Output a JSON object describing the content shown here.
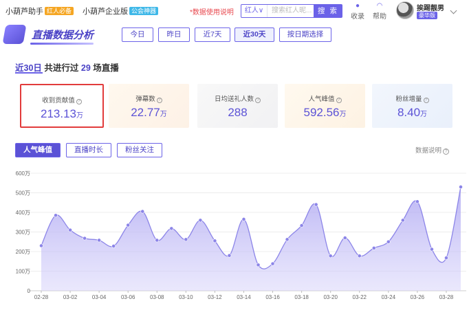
{
  "topbar": {
    "brand1": {
      "name": "小葫芦助手",
      "tag": "红人必备",
      "tag_color": "#f5a623"
    },
    "brand2": {
      "name": "小葫芦企业版",
      "tag": "公会神器",
      "tag_color": "#3fb8e8"
    },
    "warning": "*数据使用说明",
    "search": {
      "category": "红人∨",
      "placeholder": "搜索红人昵...",
      "button": "搜 索"
    },
    "tools": [
      {
        "label": "收录",
        "icon": "bag-icon"
      },
      {
        "label": "帮助",
        "icon": "headset-icon"
      }
    ],
    "user": {
      "name": "挨踢靓男",
      "badge": "豪华版"
    }
  },
  "section": {
    "title": "直播数据分析",
    "ranges": [
      "今日",
      "昨日",
      "近7天",
      "近30天",
      "按日期选择"
    ],
    "active_range": "近30天"
  },
  "summary": {
    "period": "近30日",
    "pre": "共进行过",
    "count": "29",
    "post": "场直播"
  },
  "stats": [
    {
      "label": "收到贡献值",
      "value": "213.13",
      "unit": "万"
    },
    {
      "label": "弹幕数",
      "value": "22.77",
      "unit": "万"
    },
    {
      "label": "日均送礼人数",
      "value": "288",
      "unit": ""
    },
    {
      "label": "人气峰值",
      "value": "592.56",
      "unit": "万"
    },
    {
      "label": "粉丝增量",
      "value": "8.40",
      "unit": "万"
    }
  ],
  "metric_tabs": [
    "人气峰值",
    "直播时长",
    "粉丝关注"
  ],
  "active_metric": "人气峰值",
  "data_note": "数据说明",
  "colors": {
    "accent": "#5b52d6",
    "line": "#8c85e8",
    "highlight": "#e23b3b"
  },
  "chart_data": {
    "type": "area",
    "title": "",
    "xlabel": "",
    "ylabel": "",
    "ylim": [
      0,
      600
    ],
    "y_ticks": [
      "0",
      "100万",
      "200万",
      "300万",
      "400万",
      "500万",
      "600万"
    ],
    "x_tick_labels": [
      "02-28",
      "03-02",
      "03-04",
      "03-06",
      "03-08",
      "03-10",
      "03-12",
      "03-14",
      "03-16",
      "03-18",
      "03-20",
      "03-22",
      "03-24",
      "03-26",
      "03-28"
    ],
    "x": [
      "02-28",
      "03-01",
      "03-02",
      "03-03",
      "03-04",
      "03-05",
      "03-06",
      "03-07",
      "03-08",
      "03-09",
      "03-10",
      "03-11",
      "03-12",
      "03-13",
      "03-14",
      "03-15",
      "03-16",
      "03-17",
      "03-18",
      "03-19",
      "03-20",
      "03-21",
      "03-22",
      "03-23",
      "03-24",
      "03-25",
      "03-26",
      "03-27",
      "03-28",
      "03-29"
    ],
    "series": [
      {
        "values": [
          230,
          385,
          310,
          268,
          258,
          228,
          335,
          405,
          258,
          318,
          262,
          360,
          255,
          180,
          365,
          132,
          138,
          262,
          333,
          440,
          178,
          270,
          178,
          218,
          250,
          360,
          455,
          212,
          168,
          530
        ]
      }
    ],
    "grid": true,
    "legend": "none"
  }
}
